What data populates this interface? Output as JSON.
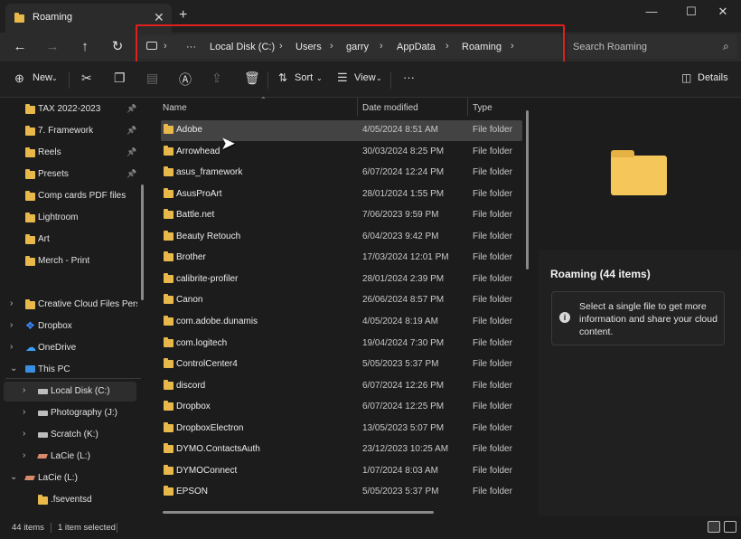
{
  "window": {
    "tab_title": "Roaming",
    "new_tab": "+",
    "tab_close": "✕",
    "minimize": "—",
    "maximize": "☐",
    "close": "✕"
  },
  "nav": {
    "back": "←",
    "forward": "→",
    "up": "↑",
    "refresh": "↻"
  },
  "breadcrumb": {
    "more": "···",
    "items": [
      "Local Disk (C:)",
      "Users",
      "garry",
      "AppData",
      "Roaming"
    ],
    "separator": "›"
  },
  "search": {
    "placeholder": "Search Roaming"
  },
  "toolbar": {
    "new_label": "New",
    "sort_label": "Sort",
    "view_label": "View",
    "more": "···",
    "details_label": "Details"
  },
  "sidebar": {
    "quick": [
      {
        "label": "TAX 2022-2023",
        "pinned": true
      },
      {
        "label": "7. Framework",
        "pinned": true
      },
      {
        "label": "Reels",
        "pinned": true
      },
      {
        "label": "Presets",
        "pinned": true
      },
      {
        "label": "Comp cards PDF files",
        "pinned": false
      },
      {
        "label": "Lightroom",
        "pinned": false
      },
      {
        "label": "Art",
        "pinned": false
      },
      {
        "label": "Merch - Print",
        "pinned": false
      }
    ],
    "tree": [
      {
        "label": "Creative Cloud Files Persona",
        "chev": "›",
        "icon": "folder"
      },
      {
        "label": "Dropbox",
        "chev": "›",
        "icon": "dropbox"
      },
      {
        "label": "OneDrive",
        "chev": "›",
        "icon": "onedrive"
      },
      {
        "label": "This PC",
        "chev": "⌄",
        "icon": "pc"
      },
      {
        "label": "Local Disk (C:)",
        "chev": "›",
        "icon": "drive"
      },
      {
        "label": "Photography (J:)",
        "chev": "›",
        "icon": "drive"
      },
      {
        "label": "Scratch (K:)",
        "chev": "›",
        "icon": "drive"
      },
      {
        "label": "LaCie (L:)",
        "chev": "›",
        "icon": "lacie"
      },
      {
        "label": "LaCie (L:)",
        "chev": "⌄",
        "icon": "lacie"
      },
      {
        "label": ".fseventsd",
        "chev": "",
        "icon": "folder"
      }
    ]
  },
  "list": {
    "headers": {
      "name": "Name",
      "date": "Date modified",
      "type": "Type"
    },
    "rows": [
      {
        "name": "Adobe",
        "date": "4/05/2024 8:51 AM",
        "type": "File folder"
      },
      {
        "name": "Arrowhead",
        "date": "30/03/2024 8:25 PM",
        "type": "File folder"
      },
      {
        "name": "asus_framework",
        "date": "6/07/2024 12:24 PM",
        "type": "File folder"
      },
      {
        "name": "AsusProArt",
        "date": "28/01/2024 1:55 PM",
        "type": "File folder"
      },
      {
        "name": "Battle.net",
        "date": "7/06/2023 9:59 PM",
        "type": "File folder"
      },
      {
        "name": "Beauty Retouch",
        "date": "6/04/2023 9:42 PM",
        "type": "File folder"
      },
      {
        "name": "Brother",
        "date": "17/03/2024 12:01 PM",
        "type": "File folder"
      },
      {
        "name": "calibrite-profiler",
        "date": "28/01/2024 2:39 PM",
        "type": "File folder"
      },
      {
        "name": "Canon",
        "date": "26/06/2024 8:57 PM",
        "type": "File folder"
      },
      {
        "name": "com.adobe.dunamis",
        "date": "4/05/2024 8:19 AM",
        "type": "File folder"
      },
      {
        "name": "com.logitech",
        "date": "19/04/2024 7:30 PM",
        "type": "File folder"
      },
      {
        "name": "ControlCenter4",
        "date": "5/05/2023 5:37 PM",
        "type": "File folder"
      },
      {
        "name": "discord",
        "date": "6/07/2024 12:26 PM",
        "type": "File folder"
      },
      {
        "name": "Dropbox",
        "date": "6/07/2024 12:25 PM",
        "type": "File folder"
      },
      {
        "name": "DropboxElectron",
        "date": "13/05/2023 5:07 PM",
        "type": "File folder"
      },
      {
        "name": "DYMO.ContactsAuth",
        "date": "23/12/2023 10:25 AM",
        "type": "File folder"
      },
      {
        "name": "DYMOConnect",
        "date": "1/07/2024 8:03 AM",
        "type": "File folder"
      },
      {
        "name": "EPSON",
        "date": "5/05/2023 5:37 PM",
        "type": "File folder"
      }
    ]
  },
  "details": {
    "title": "Roaming (44 items)",
    "message": "Select a single file to get more information and share your cloud content.",
    "info_glyph": "i"
  },
  "status": {
    "items": "44 items",
    "selected": "1 item selected"
  },
  "colors": {
    "folder": "#e8b94a",
    "highlight": "#e0201c",
    "background": "#1c1c1c"
  }
}
